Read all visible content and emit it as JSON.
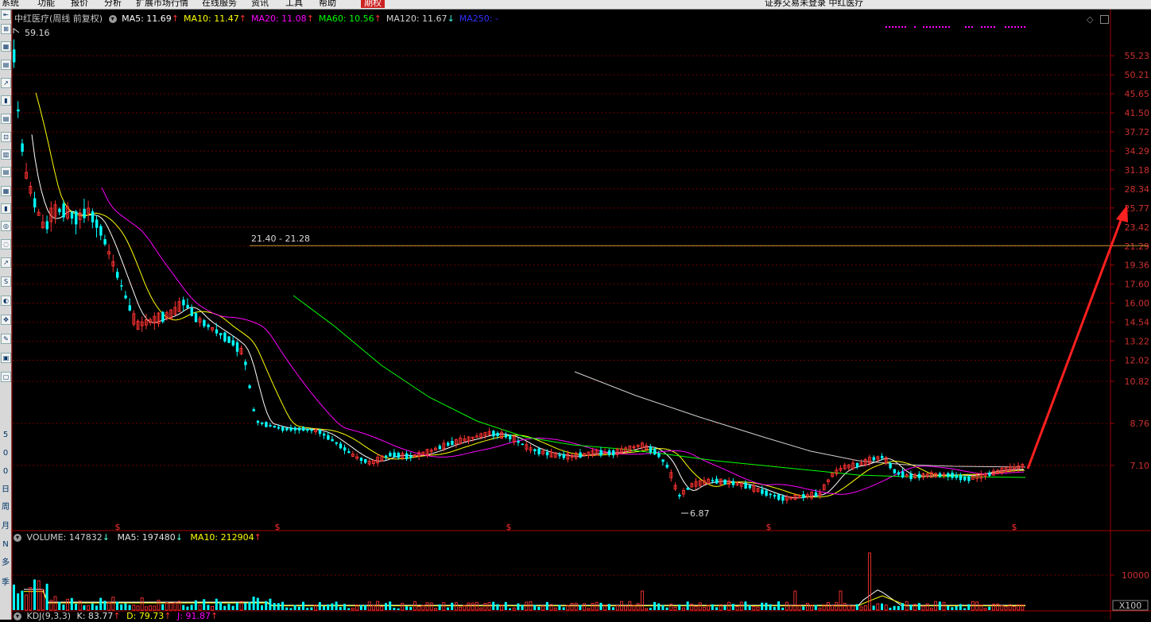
{
  "menu": {
    "items": [
      "系统",
      "功能",
      "报价",
      "分析",
      "扩展市场行情",
      "在线服务",
      "资讯",
      "工具",
      "帮助",
      "期权"
    ],
    "active_index": 9,
    "app_title": "证券交易未登录  中红医疗"
  },
  "toolbar": {
    "side_labels": [
      "5",
      "0",
      "0",
      "日",
      "周",
      "月",
      "N",
      "多",
      "季"
    ]
  },
  "colors": {
    "up": "#ff3232",
    "down": "#00ffff",
    "ma5": "#ffffff",
    "ma10": "#ffff00",
    "ma20": "#ff00ff",
    "ma60": "#00ff00",
    "ma120": "#d0d0d0",
    "ma250": "#3030ff",
    "axis": "#a00000",
    "grid": "#6e0000",
    "hline": "#c89632",
    "arrow": "#ff2020"
  },
  "main_panel": {
    "stock_label": "中红医疗(周线 前复权)",
    "ma": [
      {
        "label": "MA5: 11.69",
        "arrow": "↑",
        "color_key": "ma5"
      },
      {
        "label": "MA10: 11.47",
        "arrow": "↑",
        "color_key": "ma10"
      },
      {
        "label": "MA20: 11.08",
        "arrow": "↑",
        "color_key": "ma20"
      },
      {
        "label": "MA60: 10.56",
        "arrow": "↑",
        "color_key": "ma60"
      },
      {
        "label": "MA120: 11.67",
        "arrow": "↓",
        "color_key": "ma120"
      },
      {
        "label": "MA250: -",
        "arrow": "",
        "color_key": "ma250"
      }
    ],
    "high_label": "59.16",
    "low_label": "6.87",
    "range_label": "21.40 - 21.28",
    "range_value": 21.34,
    "y_ticks": [
      "55.23",
      "50.21",
      "45.65",
      "41.50",
      "37.72",
      "34.29",
      "31.18",
      "28.34",
      "25.77",
      "23.42",
      "21.29",
      "19.36",
      "17.60",
      "16.00",
      "14.54",
      "13.22",
      "12.02",
      "10.82",
      "8.76",
      "7.10"
    ],
    "dividend_marker": "$"
  },
  "volume_panel": {
    "title": "VOLUME: 147832",
    "title_arrow": "↓",
    "ma5": "MA5: 197480",
    "ma5_arrow": "↓",
    "ma10": "MA10: 212904",
    "ma10_arrow": "↑",
    "y_tick": "10000",
    "unit": "X100"
  },
  "kdj_panel": {
    "title": "KDJ(9,3,3)",
    "k": "K: 83.77",
    "k_arrow": "↑",
    "d": "D: 79.73",
    "d_arrow": "↑",
    "j": "J: 91.87",
    "j_arrow": "↑"
  }
}
